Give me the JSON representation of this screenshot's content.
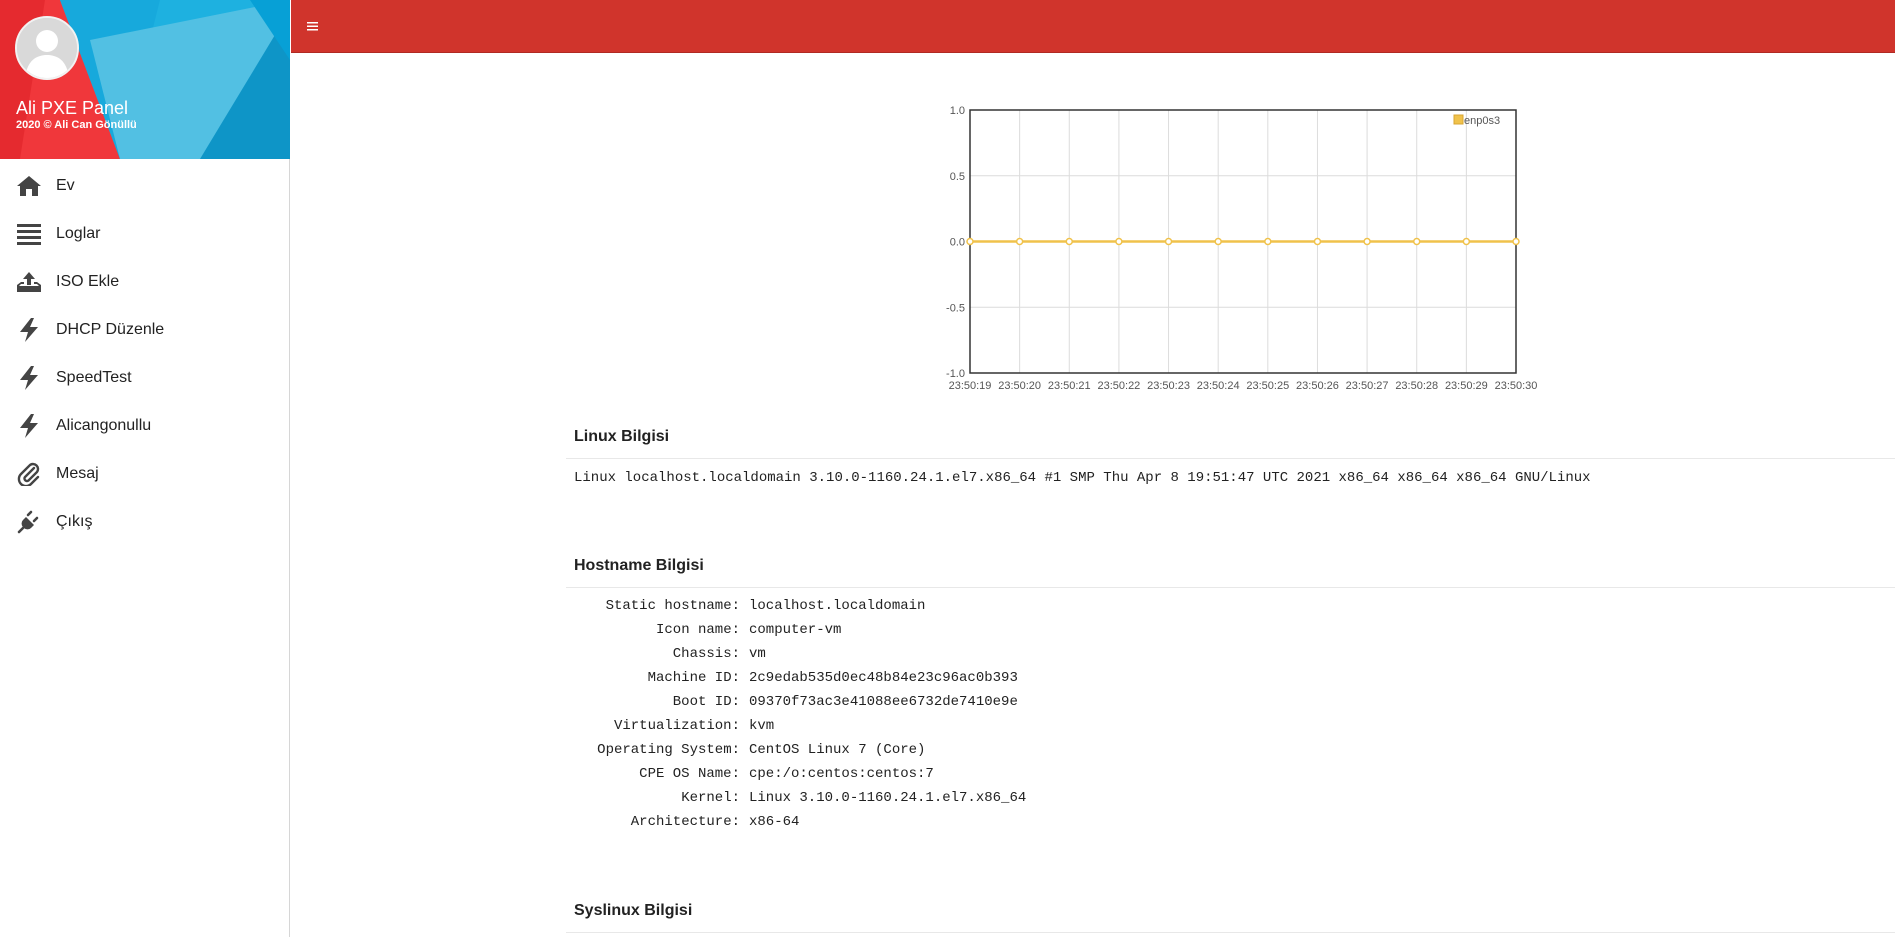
{
  "sidebar": {
    "app_name": "Ali PXE Panel",
    "copyright": "2020 © Ali Can Gönüllü",
    "items": [
      {
        "label": "Ev",
        "icon": "home-icon"
      },
      {
        "label": "Loglar",
        "icon": "list-icon"
      },
      {
        "label": "ISO Ekle",
        "icon": "upload-icon"
      },
      {
        "label": "DHCP Düzenle",
        "icon": "bolt-icon"
      },
      {
        "label": "SpeedTest",
        "icon": "bolt-icon"
      },
      {
        "label": "Alicangonullu",
        "icon": "bolt-icon"
      },
      {
        "label": "Mesaj",
        "icon": "paperclip-icon"
      },
      {
        "label": "Çıkış",
        "icon": "plug-icon"
      }
    ]
  },
  "topbar": {
    "menu_icon": "hamburger-icon",
    "color": "#d0342c"
  },
  "chart_data": {
    "type": "line",
    "x": [
      "23:50:19",
      "23:50:20",
      "23:50:21",
      "23:50:22",
      "23:50:23",
      "23:50:24",
      "23:50:25",
      "23:50:26",
      "23:50:27",
      "23:50:28",
      "23:50:29",
      "23:50:30"
    ],
    "series": [
      {
        "name": "enp0s3",
        "values": [
          0,
          0,
          0,
          0,
          0,
          0,
          0,
          0,
          0,
          0,
          0,
          0
        ],
        "color": "#f0c24b"
      }
    ],
    "ylim": [
      -1.0,
      1.0
    ],
    "yticks": [
      "1.0",
      "0.5",
      "0.0",
      "-0.5",
      "-1.0"
    ],
    "grid": true,
    "legend": "top-right"
  },
  "sections": {
    "linux": {
      "title": "Linux Bilgisi",
      "text": "Linux localhost.localdomain 3.10.0-1160.24.1.el7.x86_64 #1 SMP Thu Apr 8 19:51:47 UTC 2021 x86_64 x86_64 x86_64 GNU/Linux"
    },
    "hostname": {
      "title": "Hostname Bilgisi",
      "rows": [
        {
          "key": "Static hostname:",
          "value": "localhost.localdomain"
        },
        {
          "key": "Icon name:",
          "value": "computer-vm"
        },
        {
          "key": "Chassis:",
          "value": "vm"
        },
        {
          "key": "Machine ID:",
          "value": "2c9edab535d0ec48b84e23c96ac0b393"
        },
        {
          "key": "Boot ID:",
          "value": "09370f73ac3e41088ee6732de7410e9e"
        },
        {
          "key": "Virtualization:",
          "value": "kvm"
        },
        {
          "key": "Operating System:",
          "value": "CentOS Linux 7 (Core)"
        },
        {
          "key": "CPE OS Name:",
          "value": "cpe:/o:centos:centos:7"
        },
        {
          "key": "Kernel:",
          "value": "Linux 3.10.0-1160.24.1.el7.x86_64"
        },
        {
          "key": "Architecture:",
          "value": "x86-64"
        }
      ]
    },
    "syslinux": {
      "title": "Syslinux Bilgisi"
    }
  }
}
